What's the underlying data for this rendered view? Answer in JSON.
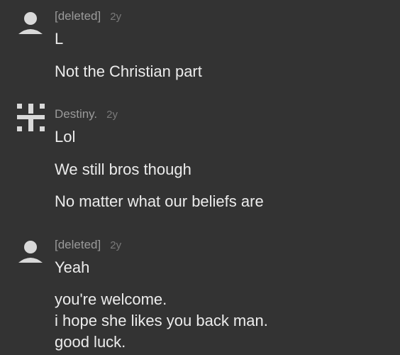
{
  "comments": [
    {
      "author": "[deleted]",
      "age": "2y",
      "avatar_icon": "default-user-icon",
      "paragraphs": [
        "L",
        "Not the Christian part"
      ]
    },
    {
      "author": "Destiny.",
      "age": "2y",
      "avatar_icon": "pattern-avatar-icon",
      "paragraphs": [
        "Lol",
        "We still bros though",
        "No matter what our beliefs are"
      ]
    },
    {
      "author": "[deleted]",
      "age": "2y",
      "avatar_icon": "default-user-icon",
      "paragraphs": [
        "Yeah",
        "you're welcome.",
        "i hope she likes you back man.",
        "good luck."
      ]
    }
  ],
  "colors": {
    "background": "#333333",
    "body_text": "#ececec",
    "meta_text": "#9a9a9a",
    "avatar": "#d9d9d9"
  }
}
